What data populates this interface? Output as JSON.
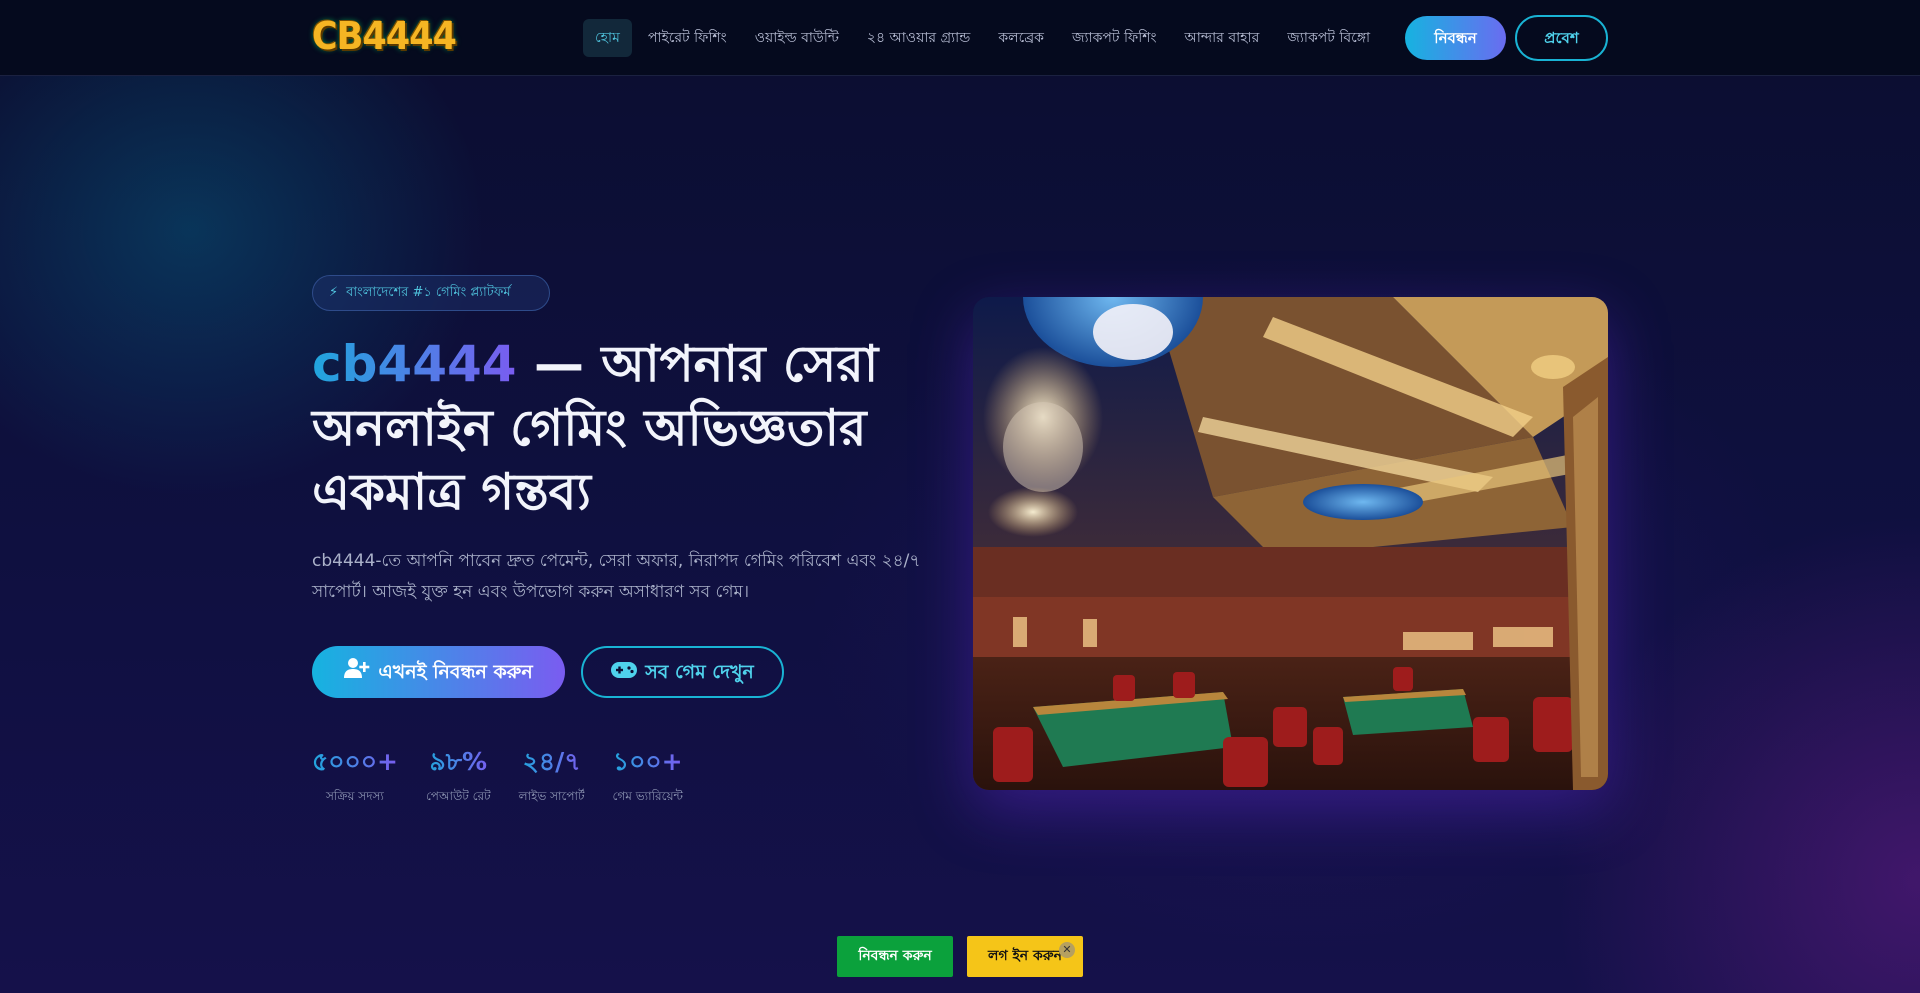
{
  "brand": {
    "logo_text": "CB4444"
  },
  "nav": {
    "items": [
      {
        "label": "হোম",
        "active": true
      },
      {
        "label": "পাইরেট ফিশিং"
      },
      {
        "label": "ওয়াইল্ড বাউন্টি"
      },
      {
        "label": "২৪ আওয়ার গ্র্যান্ড"
      },
      {
        "label": "কলব্রেক"
      },
      {
        "label": "জ্যাকপট ফিশিং"
      },
      {
        "label": "আন্দার বাহার"
      },
      {
        "label": "জ্যাকপট বিঙ্গো"
      }
    ],
    "register_label": "নিবন্ধন",
    "login_label": "প্রবেশ"
  },
  "hero": {
    "badge": "বাংলাদেশের #১ গেমিং প্ল্যাটফর্ম",
    "title_brand": "cb4444",
    "title_rest": " — আপনার সেরা অনলাইন গেমিং অভিজ্ঞতার একমাত্র গন্তব্য",
    "description": "cb4444-তে আপনি পাবেন দ্রুত পেমেন্ট, সেরা অফার, নিরাপদ গেমিং পরিবেশ এবং ২৪/৭ সাপোর্ট। আজই যুক্ত হন এবং উপভোগ করুন অসাধারণ সব গেম।",
    "cta_primary": "এখনই নিবন্ধন করুন",
    "cta_secondary": "সব গেম দেখুন",
    "stats": [
      {
        "value": "৫০০০+",
        "label": "সক্রিয় সদস্য"
      },
      {
        "value": "৯৮%",
        "label": "পেআউট রেট"
      },
      {
        "value": "২৪/৭",
        "label": "লাইভ সাপোর্ট"
      },
      {
        "value": "১০০+",
        "label": "গেম ভ্যারিয়েন্ট"
      }
    ]
  },
  "bottom_bar": {
    "register_label": "নিবন্ধন করুন",
    "login_label": "লগ ইন করুন",
    "close_glyph": "✕"
  },
  "icons": {
    "badge": "lightning-icon",
    "cta_primary": "user-plus-icon",
    "cta_secondary": "gamepad-icon"
  },
  "colors": {
    "accent_cyan": "#16b3e0",
    "accent_purple": "#7a5cf0",
    "header_bg": "#050a1e",
    "page_bg": "#0d0f33",
    "bottom_register": "#0ba13c",
    "bottom_login": "#f5c518"
  }
}
